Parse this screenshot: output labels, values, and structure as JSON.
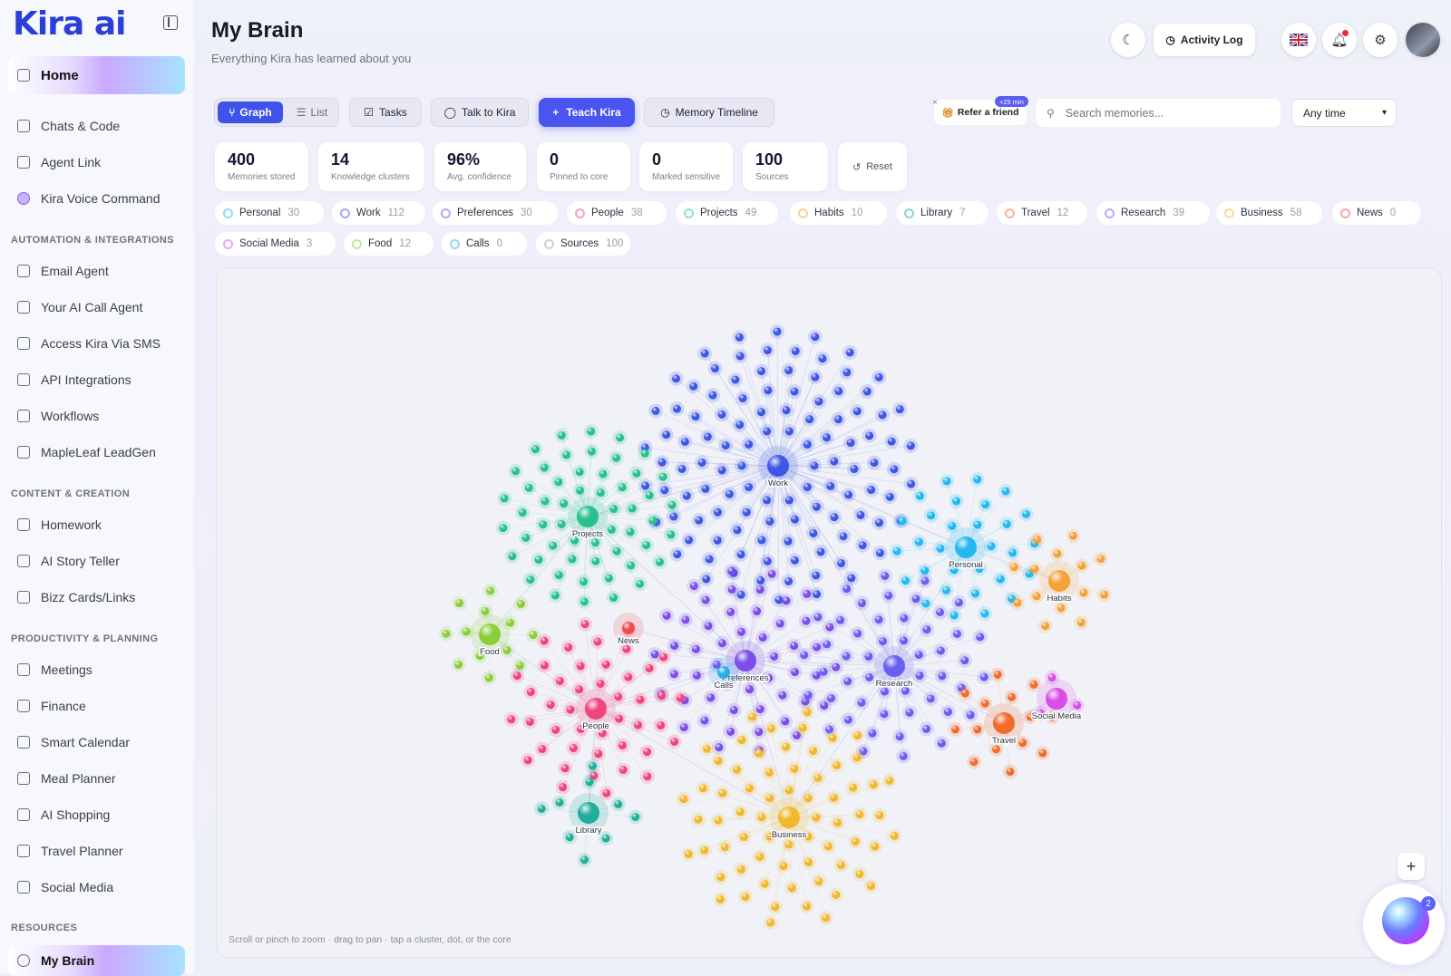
{
  "app": {
    "logo": "Kira ai"
  },
  "sidebar": {
    "home": "Home",
    "items": [
      {
        "label": "Chats & Code",
        "icon": "chat-icon"
      },
      {
        "label": "Agent Link",
        "icon": "agent-icon"
      },
      {
        "label": "Kira Voice Command",
        "icon": "voice-icon"
      }
    ],
    "sections": [
      {
        "title": "AUTOMATION & INTEGRATIONS",
        "items": [
          "Email Agent",
          "Your AI Call Agent",
          "Access Kira Via SMS",
          "API Integrations",
          "Workflows",
          "MapleLeaf LeadGen"
        ]
      },
      {
        "title": "CONTENT & CREATION",
        "items": [
          "Homework",
          "AI Story Teller",
          "Bizz Cards/Links"
        ]
      },
      {
        "title": "PRODUCTIVITY & PLANNING",
        "items": [
          "Meetings",
          "Finance",
          "Smart Calendar",
          "Meal Planner",
          "AI Shopping",
          "Travel Planner",
          "Social Media"
        ]
      },
      {
        "title": "RESOURCES",
        "items": [
          "My Brain"
        ]
      }
    ]
  },
  "header": {
    "title": "My Brain",
    "subtitle": "Everything Kira has learned about you",
    "activity_log": "Activity Log"
  },
  "toolbar": {
    "graph": "Graph",
    "list": "List",
    "tasks": "Tasks",
    "talk": "Talk to Kira",
    "teach": "Teach Kira",
    "timeline": "Memory Timeline",
    "refer": "Refer a friend",
    "refer_badge": "+25 min",
    "search_placeholder": "Search memories...",
    "time_filter": "Any time"
  },
  "stats": [
    {
      "value": "400",
      "label": "Memories stored"
    },
    {
      "value": "14",
      "label": "Knowledge clusters"
    },
    {
      "value": "96%",
      "label": "Avg. confidence"
    },
    {
      "value": "0",
      "label": "Pinned to core"
    },
    {
      "value": "0",
      "label": "Marked sensitive"
    },
    {
      "value": "100",
      "label": "Sources"
    }
  ],
  "reset": "Reset",
  "categories": [
    {
      "name": "Personal",
      "count": "30",
      "color": "#22b8f0"
    },
    {
      "name": "Work",
      "count": "112",
      "color": "#3f56e6"
    },
    {
      "name": "Preferences",
      "count": "30",
      "color": "#7b4ee8"
    },
    {
      "name": "People",
      "count": "38",
      "color": "#f0457c"
    },
    {
      "name": "Projects",
      "count": "49",
      "color": "#27c28c"
    },
    {
      "name": "Habits",
      "count": "10",
      "color": "#f5a23a"
    },
    {
      "name": "Library",
      "count": "7",
      "color": "#1fae9a"
    },
    {
      "name": "Travel",
      "count": "12",
      "color": "#f26b2a"
    },
    {
      "name": "Research",
      "count": "39",
      "color": "#6a5ef0"
    },
    {
      "name": "Business",
      "count": "58",
      "color": "#f0b82a"
    },
    {
      "name": "News",
      "count": "0",
      "color": "#f04d4d"
    },
    {
      "name": "Social Media",
      "count": "3",
      "color": "#d94ee6"
    },
    {
      "name": "Food",
      "count": "12",
      "color": "#8ccd3a"
    },
    {
      "name": "Calls",
      "count": "0",
      "color": "#2aaee8"
    },
    {
      "name": "Sources",
      "count": "100",
      "color": "#a0a4b8"
    }
  ],
  "graph": {
    "hint": "Scroll or pinch to zoom · drag to pan · tap a cluster, dot, or the core",
    "zoom_in": "+",
    "assistant_badge": "2"
  }
}
